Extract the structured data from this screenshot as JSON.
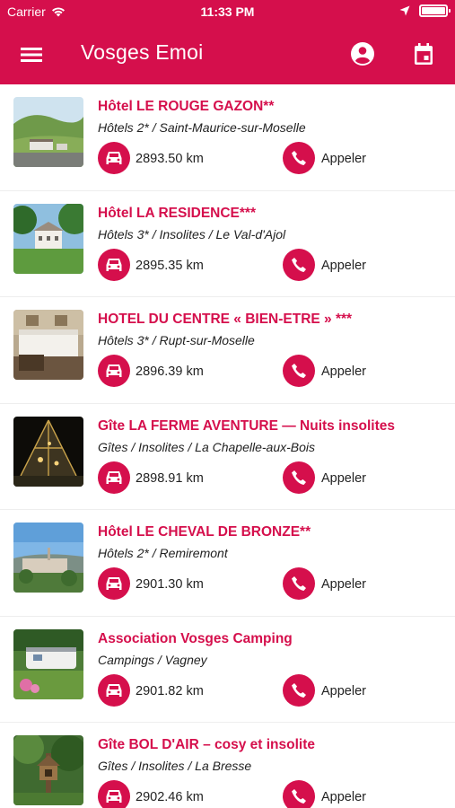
{
  "status_bar": {
    "carrier": "Carrier",
    "time": "11:33 PM"
  },
  "app": {
    "title": "Vosges Emoi"
  },
  "listings": [
    {
      "title": "Hôtel LE ROUGE GAZON**",
      "categories": "Hôtels 2* /  Saint-Maurice-sur-Moselle",
      "distance": "2893.50 km",
      "call_label": "Appeler"
    },
    {
      "title": "Hôtel LA RESIDENCE***",
      "categories": "Hôtels 3* /  Insolites /  Le Val-d'Ajol",
      "distance": "2895.35 km",
      "call_label": "Appeler"
    },
    {
      "title": "HOTEL DU CENTRE « BIEN-ETRE » ***",
      "categories": "Hôtels 3* /  Rupt-sur-Moselle",
      "distance": "2896.39 km",
      "call_label": "Appeler"
    },
    {
      "title": "Gîte LA FERME AVENTURE — Nuits insolites",
      "categories": "Gîtes /  Insolites /  La Chapelle-aux-Bois",
      "distance": "2898.91 km",
      "call_label": "Appeler"
    },
    {
      "title": "Hôtel LE CHEVAL DE BRONZE**",
      "categories": "Hôtels 2* /  Remiremont",
      "distance": "2901.30 km",
      "call_label": "Appeler"
    },
    {
      "title": "Association Vosges Camping",
      "categories": "Campings /  Vagney",
      "distance": "2901.82 km",
      "call_label": "Appeler"
    },
    {
      "title": "Gîte BOL D'AIR – cosy et insolite",
      "categories": "Gîtes /  Insolites /  La Bresse",
      "distance": "2902.46 km",
      "call_label": "Appeler"
    }
  ],
  "colors": {
    "brand": "#d50f4c",
    "text": "#222222"
  },
  "icons": [
    "menu-icon",
    "account-icon",
    "calendar-icon",
    "car-icon",
    "phone-icon",
    "wifi-icon",
    "location-arrow-icon",
    "battery-icon"
  ]
}
